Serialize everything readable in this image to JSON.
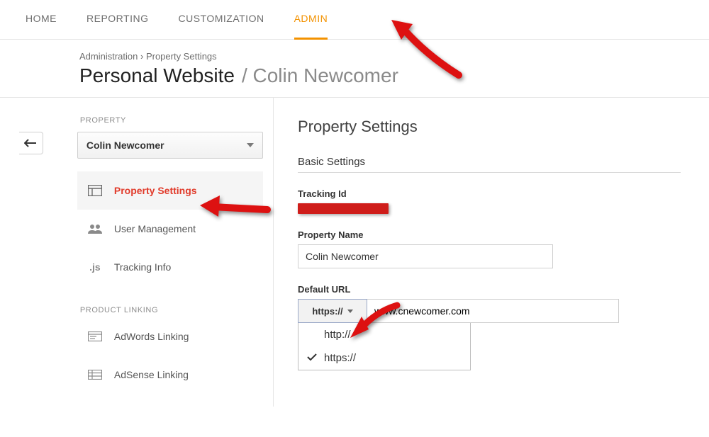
{
  "nav": {
    "home": "HOME",
    "reporting": "REPORTING",
    "customization": "CUSTOMIZATION",
    "admin": "ADMIN"
  },
  "breadcrumb": {
    "root": "Administration",
    "sep": " › ",
    "current": "Property Settings"
  },
  "title": {
    "main": "Personal Website",
    "divider": "/",
    "sub": "Colin Newcomer"
  },
  "sidebar": {
    "property_label": "PROPERTY",
    "property_selected": "Colin Newcomer",
    "items": {
      "property_settings": "Property Settings",
      "user_management": "User Management",
      "tracking_info": "Tracking Info"
    },
    "linking_label": "PRODUCT LINKING",
    "linking": {
      "adwords": "AdWords Linking",
      "adsense": "AdSense Linking"
    }
  },
  "content": {
    "heading": "Property Settings",
    "basic": "Basic Settings",
    "tracking_id_label": "Tracking Id",
    "property_name_label": "Property Name",
    "property_name_value": "Colin Newcomer",
    "default_url_label": "Default URL",
    "protocol_selected": "https://",
    "url_value": "www.cnewcomer.com",
    "protocol_options": {
      "http": "http://",
      "https": "https://"
    }
  }
}
